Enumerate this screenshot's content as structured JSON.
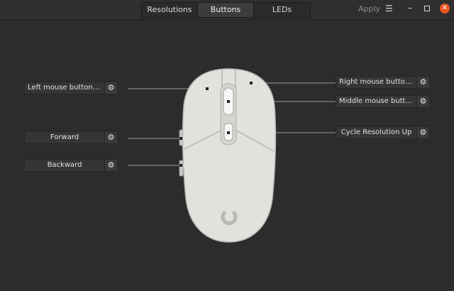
{
  "tabs": [
    {
      "label": "Resolutions",
      "active": false
    },
    {
      "label": "Buttons",
      "active": true
    },
    {
      "label": "LEDs",
      "active": false
    }
  ],
  "header": {
    "apply_label": "Apply",
    "menu_icon": "hamburger-menu-icon",
    "minimize_icon": "minimize-icon",
    "maximize_icon": "maximize-icon",
    "close_icon": "close-icon",
    "close_color": "#e95420"
  },
  "buttons": {
    "left": {
      "label": "Left mouse button click",
      "icon": "gear-icon"
    },
    "forward": {
      "label": "Forward",
      "icon": "gear-icon"
    },
    "backward": {
      "label": "Backward",
      "icon": "gear-icon"
    },
    "right": {
      "label": "Right mouse button click",
      "icon": "gear-icon"
    },
    "middle": {
      "label": "Middle mouse button click",
      "icon": "gear-icon"
    },
    "cycle": {
      "label": "Cycle Resolution Up",
      "icon": "gear-icon"
    }
  },
  "glyphs": {
    "gear": "⚙",
    "menu": "☰",
    "minimize": "–",
    "close": "✕"
  }
}
